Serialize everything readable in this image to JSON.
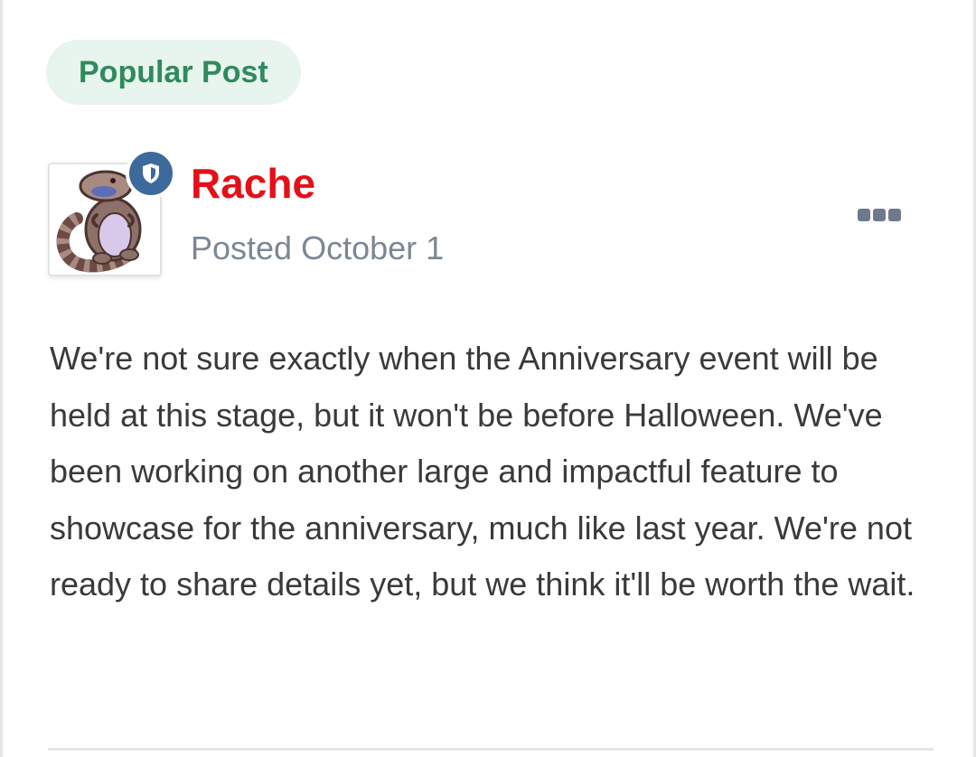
{
  "post": {
    "badge_label": "Popular Post",
    "author": {
      "name": "Rache",
      "name_color": "#e3101a",
      "avatar_icon": "lizard-avatar",
      "role_icon": "shield-icon"
    },
    "posted_label": "Posted October 1",
    "menu_icon": "more-options-icon",
    "body": "We're not sure exactly when the Anniversary event will be held at this stage, but it won't be before Halloween. We've been working on another large and impactful feature to showcase for the anniversary, much like last year. We're not ready to share details yet, but we think it'll be worth the wait."
  },
  "colors": {
    "badge_background": "#e8f4ee",
    "badge_text": "#2f8a5c",
    "role_badge": "#3d6a9c",
    "meta_text": "#7b8794",
    "body_text": "#3a3a3a"
  }
}
